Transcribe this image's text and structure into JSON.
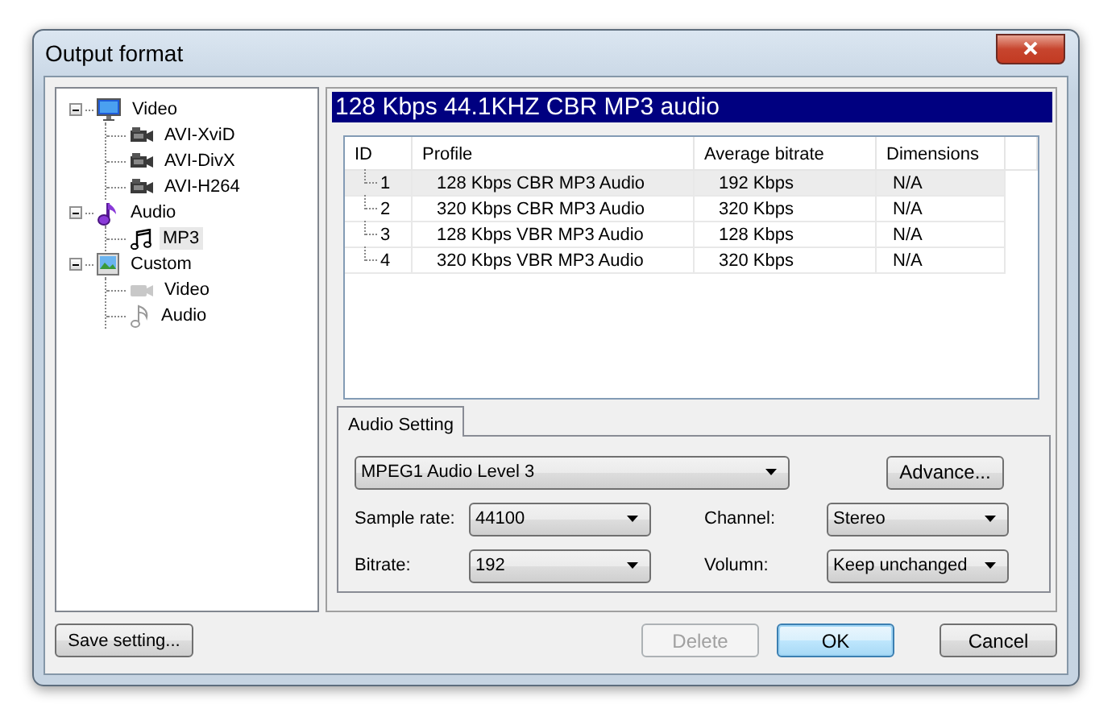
{
  "window": {
    "title": "Output format"
  },
  "tree": [
    {
      "label": "Video",
      "kind": "video",
      "expanded": true,
      "selected": false,
      "children": [
        {
          "label": "AVI-XviD",
          "kind": "codec",
          "selected": false
        },
        {
          "label": "AVI-DivX",
          "kind": "codec",
          "selected": false
        },
        {
          "label": "AVI-H264",
          "kind": "codec",
          "selected": false
        }
      ]
    },
    {
      "label": "Audio",
      "kind": "audio",
      "expanded": true,
      "selected": false,
      "children": [
        {
          "label": "MP3",
          "kind": "track",
          "selected": true
        }
      ]
    },
    {
      "label": "Custom",
      "kind": "custom",
      "expanded": true,
      "selected": false,
      "children": [
        {
          "label": "Video",
          "kind": "custom-video",
          "selected": false
        },
        {
          "label": "Audio",
          "kind": "custom-audio",
          "selected": false
        }
      ]
    }
  ],
  "preset_header": "128 Kbps 44.1KHZ CBR MP3 audio",
  "table": {
    "columns": [
      "ID",
      "Profile",
      "Average bitrate",
      "Dimensions"
    ],
    "rows": [
      {
        "id": "1",
        "profile": "128 Kbps CBR MP3 Audio",
        "bitrate": "192 Kbps",
        "dimensions": "N/A",
        "selected": true
      },
      {
        "id": "2",
        "profile": "320 Kbps CBR MP3 Audio",
        "bitrate": "320 Kbps",
        "dimensions": "N/A",
        "selected": false
      },
      {
        "id": "3",
        "profile": "128 Kbps VBR MP3 Audio",
        "bitrate": "128 Kbps",
        "dimensions": "N/A",
        "selected": false
      },
      {
        "id": "4",
        "profile": "320 Kbps VBR MP3 Audio",
        "bitrate": "320 Kbps",
        "dimensions": "N/A",
        "selected": false
      }
    ]
  },
  "tabs": [
    {
      "label": "Audio Setting",
      "selected": true
    }
  ],
  "audio_setting": {
    "codec": "MPEG1 Audio Level 3",
    "advance_button": "Advance...",
    "fields": [
      {
        "label": "Sample rate:",
        "value": "44100"
      },
      {
        "label": "Channel:",
        "value": "Stereo"
      },
      {
        "label": "Bitrate:",
        "value": "192"
      },
      {
        "label": "Volumn:",
        "value": "Keep unchanged"
      }
    ]
  },
  "buttons": [
    {
      "label": "Save setting...",
      "kind": "save",
      "disabled": false,
      "default": false
    },
    {
      "label": "Delete",
      "kind": "action",
      "disabled": true,
      "default": false
    },
    {
      "label": "OK",
      "kind": "action",
      "disabled": false,
      "default": true
    },
    {
      "label": "Cancel",
      "kind": "action",
      "disabled": false,
      "default": false
    }
  ]
}
